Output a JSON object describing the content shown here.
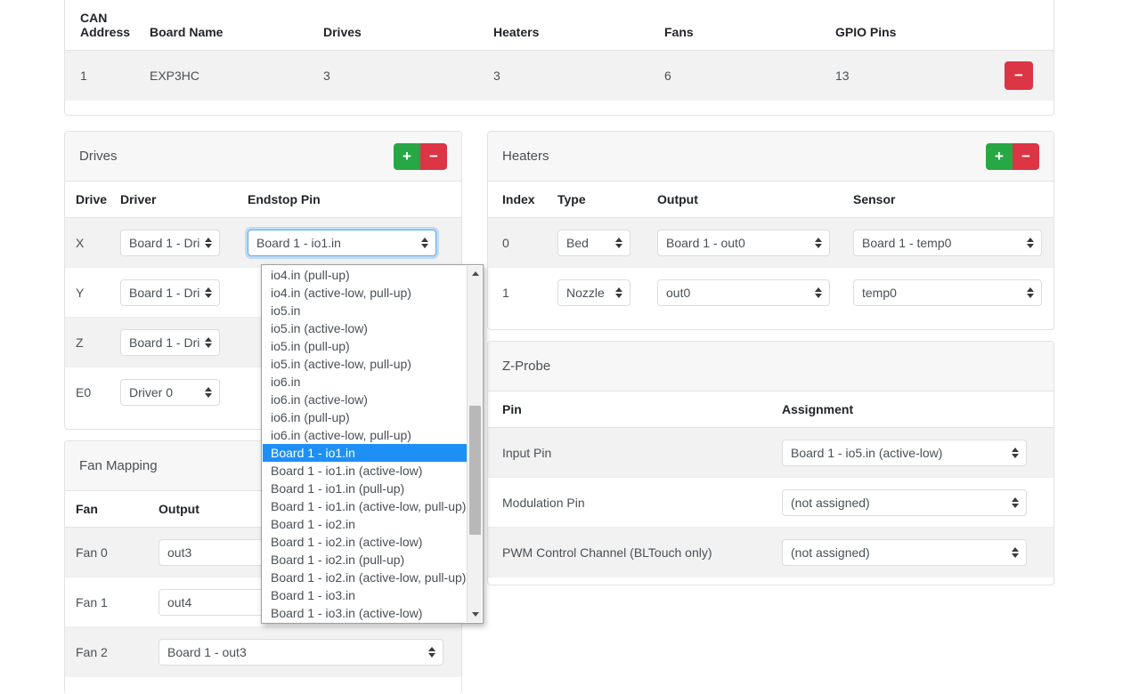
{
  "boards_table": {
    "headers": [
      "CAN Address",
      "Board Name",
      "Drives",
      "Heaters",
      "Fans",
      "GPIO Pins"
    ],
    "header_can_line1": "CAN",
    "header_can_line2": "Address",
    "rows": [
      {
        "can_address": "1",
        "board_name": "EXP3HC",
        "drives": "3",
        "heaters": "3",
        "fans": "6",
        "gpio_pins": "13",
        "delete_label": "−"
      }
    ]
  },
  "drives": {
    "title": "Drives",
    "add_label": "+",
    "remove_label": "−",
    "headers": [
      "Drive",
      "Driver",
      "Endstop Pin"
    ],
    "rows": [
      {
        "drive": "X",
        "driver": "Board 1 - Dri",
        "endstop": "Board 1 - io1.in"
      },
      {
        "drive": "Y",
        "driver": "Board 1 - Dri",
        "endstop": ""
      },
      {
        "drive": "Z",
        "driver": "Board 1 - Dri",
        "endstop": ""
      },
      {
        "drive": "E0",
        "driver": "Driver 0",
        "endstop": ""
      }
    ]
  },
  "endstop_dropdown": {
    "options": [
      "io4.in (pull-up)",
      "io4.in (active-low, pull-up)",
      "io5.in",
      "io5.in (active-low)",
      "io5.in (pull-up)",
      "io5.in (active-low, pull-up)",
      "io6.in",
      "io6.in (active-low)",
      "io6.in (pull-up)",
      "io6.in (active-low, pull-up)",
      "Board 1 - io1.in",
      "Board 1 - io1.in (active-low)",
      "Board 1 - io1.in (pull-up)",
      "Board 1 - io1.in (active-low, pull-up)",
      "Board 1 - io2.in",
      "Board 1 - io2.in (active-low)",
      "Board 1 - io2.in (pull-up)",
      "Board 1 - io2.in (active-low, pull-up)",
      "Board 1 - io3.in",
      "Board 1 - io3.in (active-low)"
    ],
    "selected": "Board 1 - io1.in",
    "selected_index": 10
  },
  "fan_mapping": {
    "title": "Fan Mapping",
    "headers": [
      "Fan",
      "Output"
    ],
    "rows": [
      {
        "fan": "Fan 0",
        "output": "out3"
      },
      {
        "fan": "Fan 1",
        "output": "out4"
      },
      {
        "fan": "Fan 2",
        "output": "Board 1 - out3"
      }
    ]
  },
  "heaters": {
    "title": "Heaters",
    "add_label": "+",
    "remove_label": "−",
    "headers": [
      "Index",
      "Type",
      "Output",
      "Sensor"
    ],
    "rows": [
      {
        "index": "0",
        "type": "Bed",
        "output": "Board 1 - out0",
        "sensor": "Board 1 - temp0"
      },
      {
        "index": "1",
        "type": "Nozzle",
        "output": "out0",
        "sensor": "temp0"
      }
    ]
  },
  "zprobe": {
    "title": "Z-Probe",
    "headers": [
      "Pin",
      "Assignment"
    ],
    "rows": [
      {
        "pin": "Input Pin",
        "assignment": "Board 1 - io5.in (active-low)"
      },
      {
        "pin": "Modulation Pin",
        "assignment": "(not assigned)"
      },
      {
        "pin": "PWM Control Channel (BLTouch only)",
        "assignment": "(not assigned)"
      }
    ]
  },
  "colors": {
    "add_green": "#28a745",
    "remove_red": "#dc3545",
    "dropdown_highlight": "#1e90f5",
    "focus_blue": "#59aaf0",
    "stripe": "#f2f2f2",
    "card_header": "#f7f7f7"
  }
}
